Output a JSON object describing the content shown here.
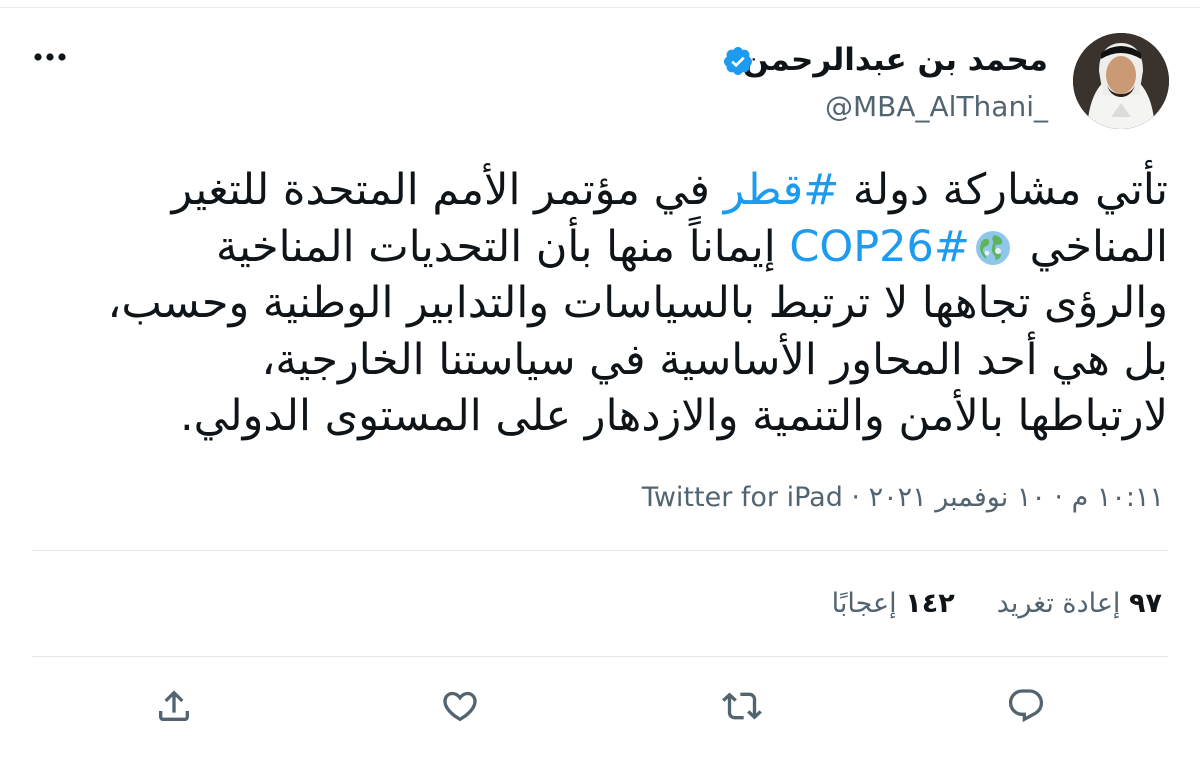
{
  "user": {
    "display_name": "محمد بن عبدالرحمن",
    "handle": "@MBA_AlThani_"
  },
  "tweet": {
    "lines": [
      [
        {
          "text": "تأتي مشاركة دولة ",
          "type": "text"
        },
        {
          "text": "#قطر",
          "type": "hashtag"
        },
        {
          "text": " في مؤتمر الأمم المتحدة للتغير",
          "type": "text"
        }
      ],
      [
        {
          "text": "المناخي ",
          "type": "text"
        },
        {
          "text": "",
          "type": "globe"
        },
        {
          "text": "#COP26",
          "type": "hashtag"
        },
        {
          "text": " إيماناً منها بأن التحديات المناخية",
          "type": "text"
        }
      ],
      [
        {
          "text": "والرؤى تجاهها لا ترتبط بالسياسات والتدابير الوطنية وحسب،",
          "type": "text"
        }
      ],
      [
        {
          "text": "بل هي أحد المحاور الأساسية في سياستنا الخارجية،",
          "type": "text"
        }
      ],
      [
        {
          "text": "لارتباطها بالأمن والتنمية والازدهار على المستوى الدولي.",
          "type": "text"
        }
      ]
    ]
  },
  "meta": {
    "time": "١٠:١١ م",
    "separator": " · ",
    "date": "١٠ نوفمبر ٢٠٢١",
    "source": "Twitter for iPad"
  },
  "stats": {
    "retweets_count": "٩٧",
    "retweets_label": "إعادة تغريد",
    "likes_count": "١٤٢",
    "likes_label": "إعجابًا"
  },
  "icons": {
    "verified": "verified-badge-icon",
    "more": "more-horizontal-icon",
    "reply": "reply-icon",
    "retweet": "retweet-icon",
    "like": "heart-icon",
    "share": "share-icon",
    "globe": "globe-emoji-icon"
  },
  "colors": {
    "accent": "#1d9bf0",
    "text": "#0f1419",
    "secondary": "#536471",
    "divider": "#e1e8ed"
  }
}
